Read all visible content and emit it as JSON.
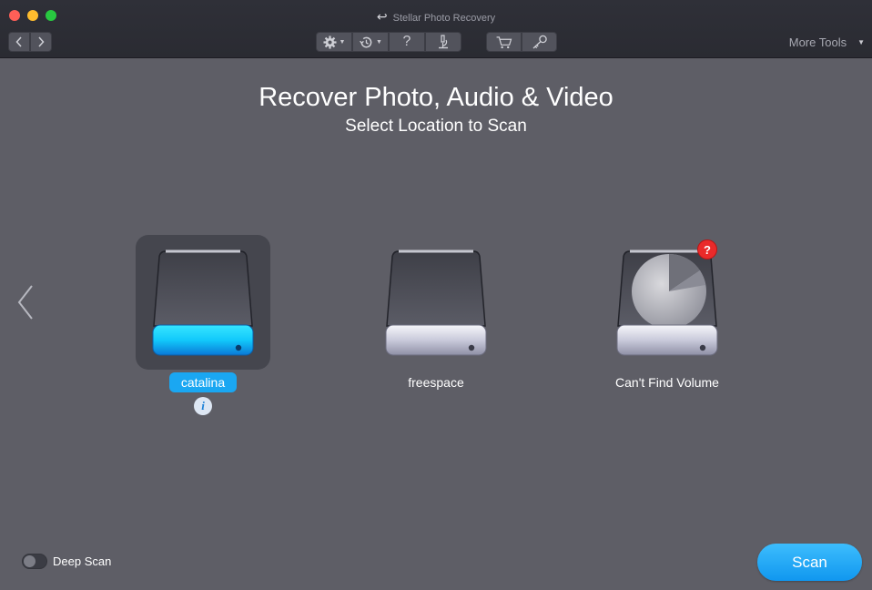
{
  "window": {
    "title": "Stellar Photo Recovery"
  },
  "toolbar": {
    "back_icon": "chevron-left-icon",
    "forward_icon": "chevron-right-icon",
    "tools": [
      {
        "name": "settings",
        "icon": "gear-icon",
        "has_dropdown": true
      },
      {
        "name": "history",
        "icon": "history-icon",
        "has_dropdown": true
      },
      {
        "name": "help",
        "icon": "question-mark-icon",
        "label": "?"
      },
      {
        "name": "log",
        "icon": "microscope-icon"
      }
    ],
    "shop": [
      {
        "name": "cart",
        "icon": "cart-icon"
      },
      {
        "name": "activate",
        "icon": "key-icon"
      }
    ],
    "more_tools_label": "More Tools"
  },
  "main": {
    "title": "Recover Photo, Audio & Video",
    "subtitle": "Select Location to Scan"
  },
  "drives": [
    {
      "label": "catalina",
      "selected": true,
      "icon": "hard-drive-icon",
      "has_info": true,
      "info_glyph": "i"
    },
    {
      "label": "freespace",
      "selected": false,
      "icon": "hard-drive-icon"
    },
    {
      "label": "Can't Find Volume",
      "selected": false,
      "icon": "hard-drive-pie-icon",
      "badge": "?"
    }
  ],
  "footer": {
    "deep_scan_label": "Deep Scan",
    "deep_scan_enabled": false,
    "scan_button_label": "Scan"
  },
  "colors": {
    "accent": "#1aa7f2",
    "background": "#5e5e66",
    "titlebar": "#2f3038",
    "warning": "#ea2a2a"
  }
}
